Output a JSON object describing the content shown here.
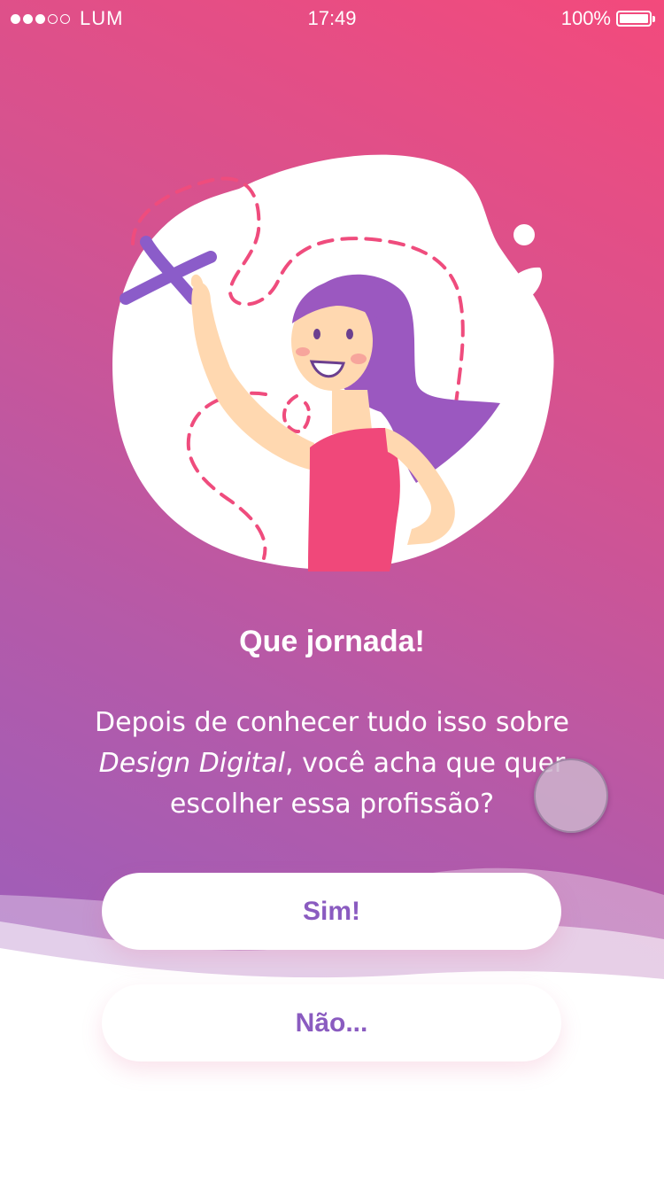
{
  "status_bar": {
    "signal": "●●●○○",
    "carrier": "LUM",
    "time": "17:49",
    "battery_percent": "100%",
    "battery_level": 1.0
  },
  "illustration": {
    "icon": "girl-pointing-map-illustration"
  },
  "content": {
    "title": "Que jornada!",
    "question_line1": "Depois de conhecer tudo isso sobre",
    "question_emphasis": "Design Digital",
    "question_line2_rest": ", você acha que quer",
    "question_line3": "escolher essa profissão?"
  },
  "actions": {
    "yes_label": "Sim!",
    "no_label": "Não..."
  },
  "colors": {
    "gradient_top": "#f34a7c",
    "gradient_bottom": "#9060c4",
    "button_text": "#8a5bc0",
    "illustration_accent": "#8b5cc9",
    "dress": "#f0487a"
  }
}
